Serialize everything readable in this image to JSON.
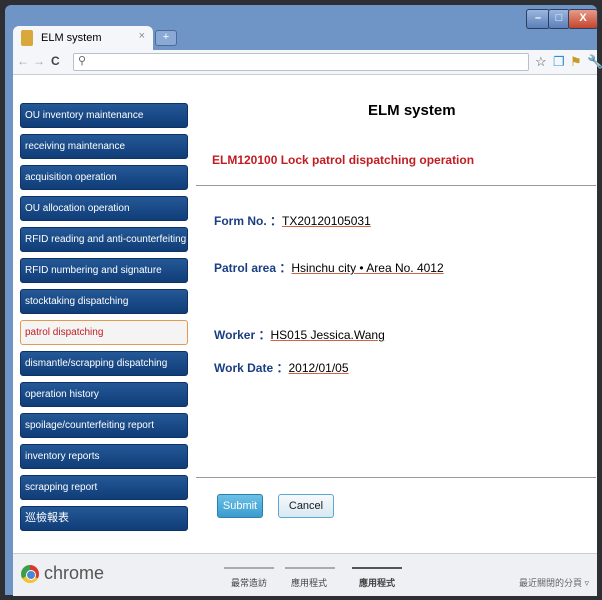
{
  "browser": {
    "tab_title": "ELM system",
    "tab_close": "×",
    "new_tab": "+",
    "back": "←",
    "forward": "→",
    "reload": "C",
    "omnibox_icon": "search-icon",
    "window_controls": {
      "minimize": "–",
      "maximize": "□",
      "close": "X"
    }
  },
  "sidebar": {
    "items": [
      {
        "label": "OU inventory maintenance"
      },
      {
        "label": "receiving maintenance"
      },
      {
        "label": "acquisition operation"
      },
      {
        "label": "OU allocation operation"
      },
      {
        "label": "RFID reading and anti-counterfeiting"
      },
      {
        "label": "RFID numbering and signature"
      },
      {
        "label": "stocktaking dispatching"
      },
      {
        "label": "patrol dispatching"
      },
      {
        "label": "dismantle/scrapping dispatching"
      },
      {
        "label": "operation history"
      },
      {
        "label": "spoilage/counterfeiting report"
      },
      {
        "label": "inventory reports"
      },
      {
        "label": "scrapping report"
      },
      {
        "label": "巡檢報表"
      }
    ],
    "active_index": 7
  },
  "main": {
    "system_title": "ELM system",
    "operation_title": "ELM120100  Lock patrol dispatching operation",
    "form_no": {
      "label": "Form No. ：",
      "value": "TX20120105031"
    },
    "patrol_area": {
      "label": "Patrol area ：",
      "value": "Hsinchu city • Area  No. 4012"
    },
    "worker": {
      "label": "Worker ：",
      "value": "HS015  Jessica.Wang"
    },
    "work_date": {
      "label": "Work Date ：",
      "value": "2012/01/05"
    },
    "submit": "Submit",
    "cancel": "Cancel"
  },
  "bottom_bar": {
    "brand": "chrome",
    "tabs": [
      "最常造訪",
      "應用程式",
      "應用程式"
    ],
    "recent": "最近關閉的分頁 ▿"
  },
  "colors": {
    "nav_blue": "#103d78",
    "active_border": "#e39a4f",
    "accent_red": "#c01d22",
    "label_blue": "#1a3e82",
    "submit_blue": "#3b9ccf"
  }
}
